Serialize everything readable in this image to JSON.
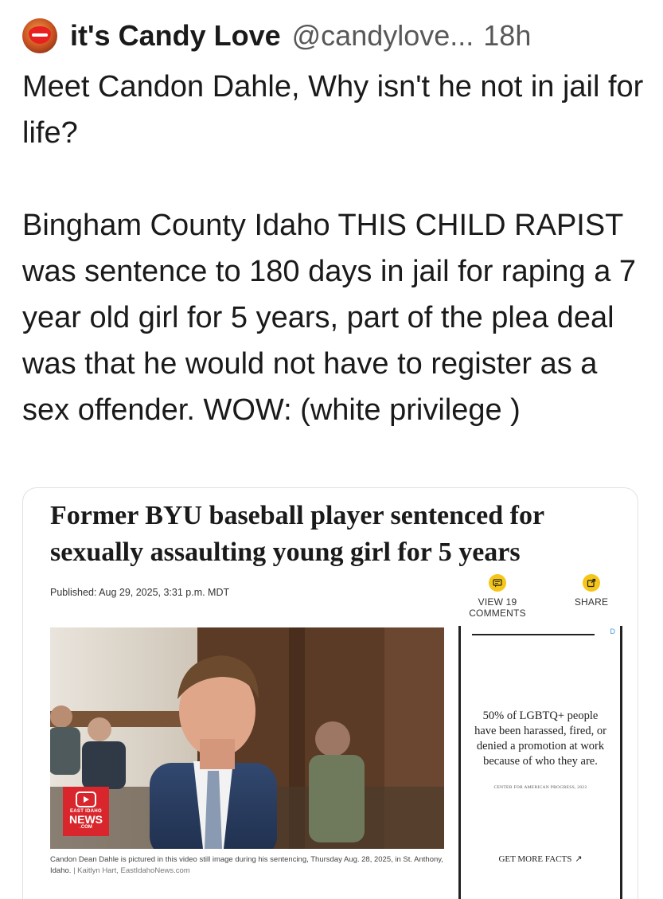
{
  "post": {
    "display_name": "it's Candy Love",
    "handle": "@candylove...",
    "timestamp": "18h",
    "text_lines": [
      "Meet Candon Dahle, Why isn't he not in jail for life?",
      "Bingham County Idaho THIS CHILD RAPIST was sentence to 180 days in jail for raping a 7 year old girl for 5 years, part of the plea deal was that he would not have to register as a sex offender. WOW: (white privilege )"
    ]
  },
  "article": {
    "headline": "Former BYU baseball player sentenced for sexually assaulting young girl for 5 years",
    "published": "Published: Aug 29, 2025, 3:31 p.m. MDT",
    "comments_label": "VIEW 19 COMMENTS",
    "share_label": "SHARE",
    "news_logo": {
      "line1": "EAST IDAHO",
      "line2": "NEWS",
      "line3": ".COM"
    },
    "caption": "Candon Dean Dahle is pictured in this video still image during his sentencing, Thursday Aug. 28, 2025, in St. Anthony, Idaho.",
    "credit": "| Kaitlyn Hart, EastIdahoNews.com"
  },
  "ad": {
    "text": "50% of LGBTQ+ people have been harassed, fired, or denied a promotion at work because of who they are.",
    "source": "CENTER FOR AMERICAN PROGRESS, 2022",
    "cta": "GET MORE FACTS",
    "cta_icon": "arrow-up-right-icon",
    "choices_label": "D"
  },
  "colors": {
    "accent_yellow": "#f5c518",
    "news_red": "#d8262c",
    "text": "#1a1a1a",
    "muted": "#585858"
  }
}
